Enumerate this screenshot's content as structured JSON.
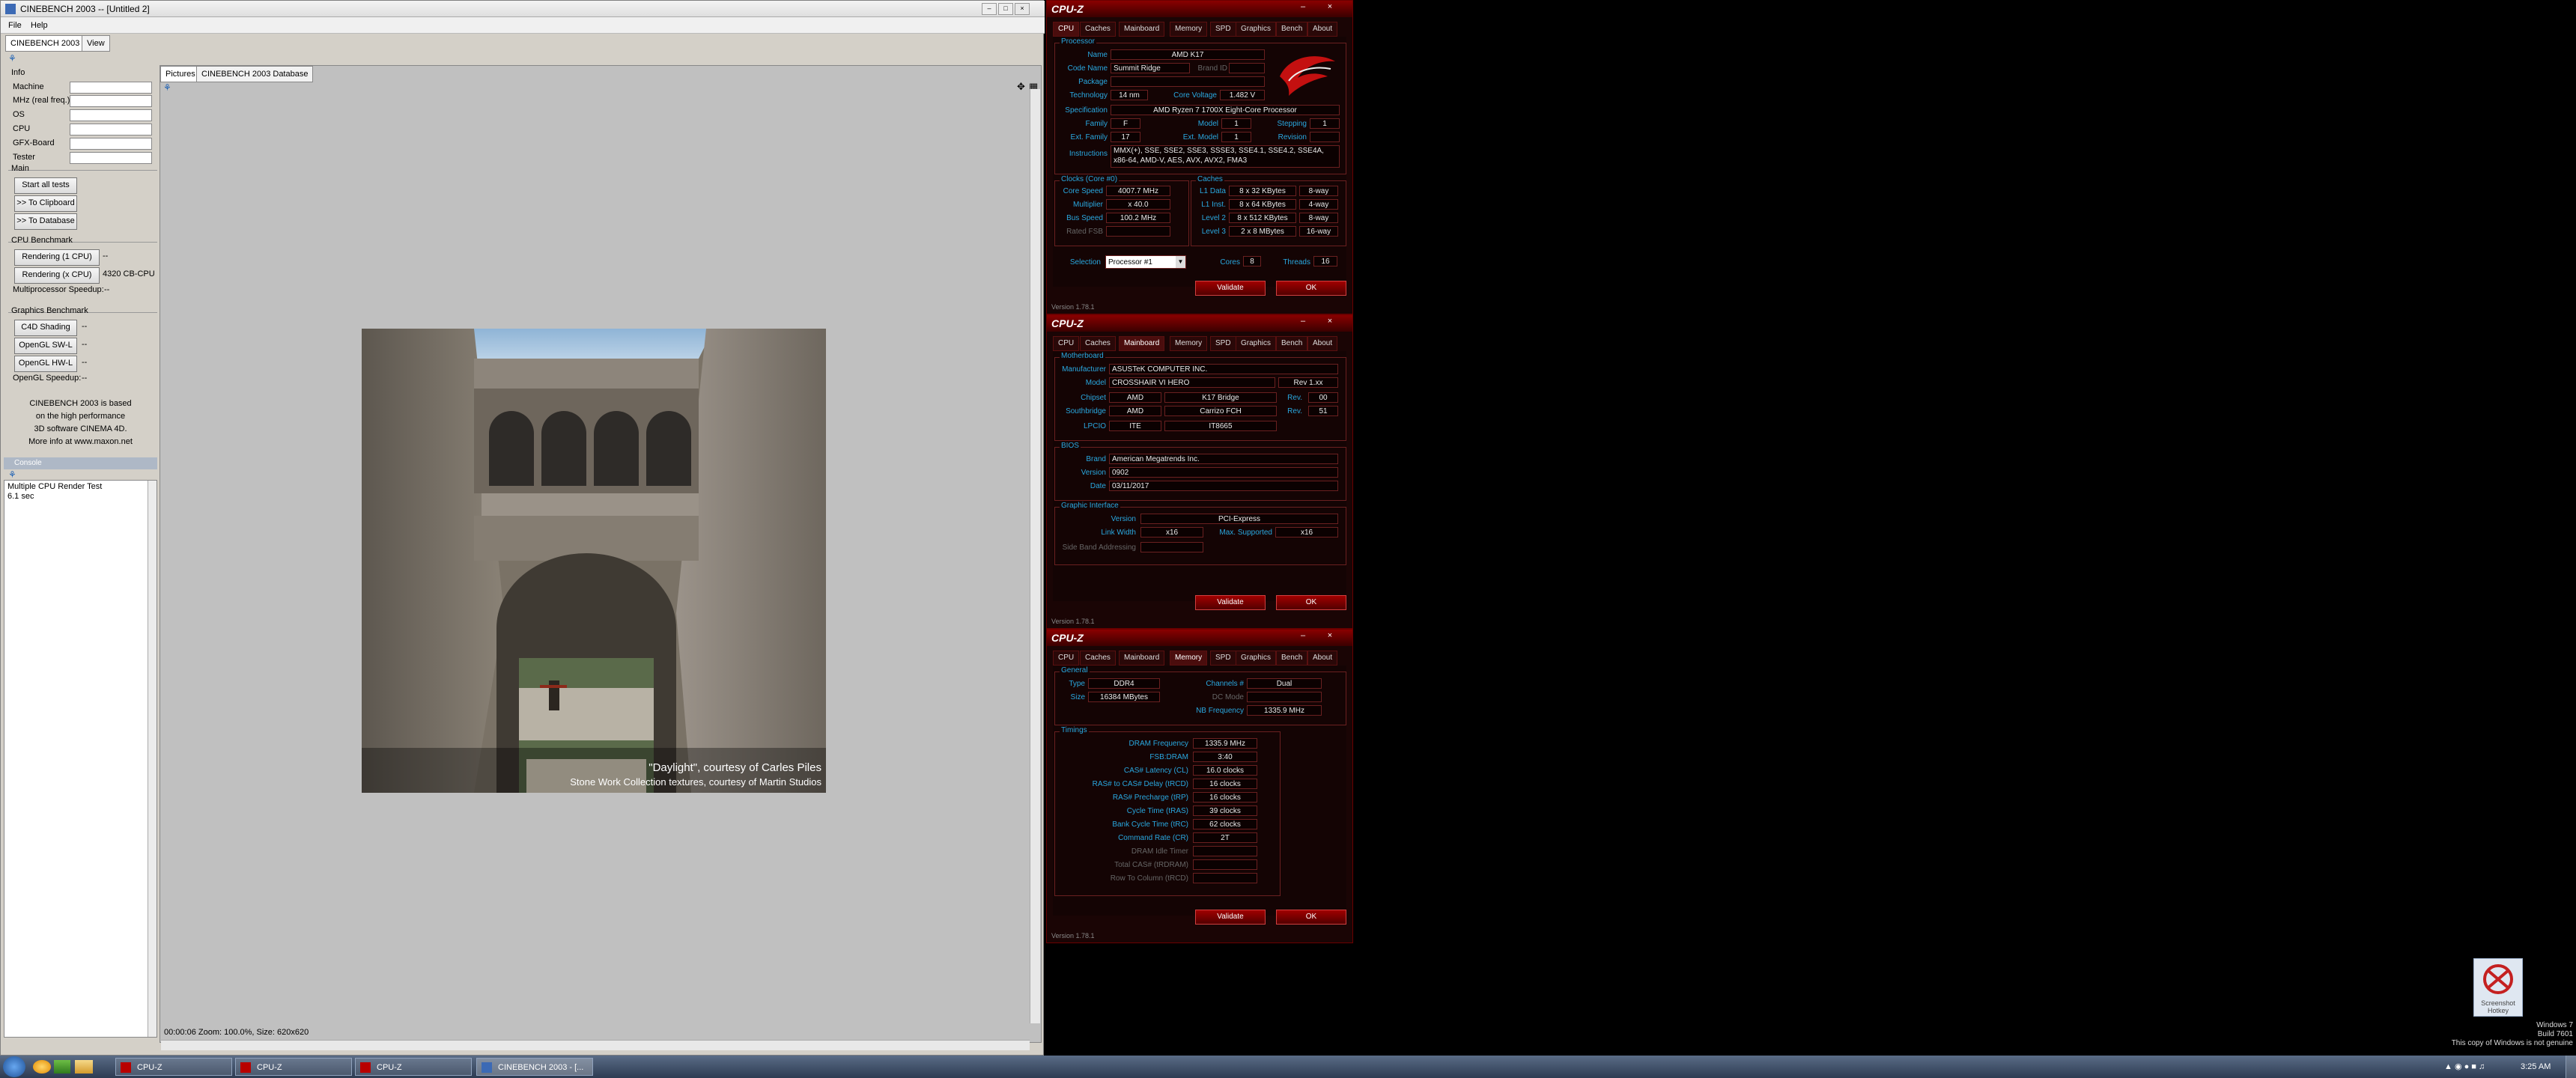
{
  "cinebench": {
    "title": "CINEBENCH 2003 -- [Untitled 2]",
    "menu": [
      "File",
      "Help"
    ],
    "tabs": [
      "CINEBENCH 2003",
      "View"
    ],
    "info": {
      "label": "Info",
      "rows": [
        "Machine",
        "MHz (real freq.)",
        "OS",
        "CPU",
        "GFX-Board",
        "Tester"
      ]
    },
    "main": {
      "label": "Main",
      "buttons": [
        "Start all tests",
        ">> To Clipboard",
        ">> To Database"
      ]
    },
    "cpu_bench": {
      "label": "CPU Benchmark",
      "single": "Rendering (1 CPU)",
      "single_value": "--",
      "multi": "Rendering (x CPU)",
      "multi_value": "4320 CB-CPU",
      "speedup_label": "Multiprocessor Speedup:",
      "speedup_value": "--"
    },
    "gfx_bench": {
      "label": "Graphics Benchmark",
      "items": [
        "C4D Shading",
        "OpenGL SW-L",
        "OpenGL HW-L"
      ],
      "values": [
        "--",
        "--",
        "--"
      ],
      "speedup_label": "OpenGL Speedup:",
      "speedup_value": "--"
    },
    "about": [
      "CINEBENCH 2003 is based",
      "on the high performance",
      "3D software CINEMA 4D.",
      "More info at www.maxon.net"
    ],
    "console": {
      "title": "Console",
      "lines": [
        "Multiple CPU Render Test",
        "6.1 sec"
      ]
    },
    "view_tabs": [
      "Pictures",
      "CINEBENCH 2003 Database"
    ],
    "render_caption": {
      "line1": "\"Daylight\", courtesy of Carles Piles",
      "line2": "Stone Work Collection textures, courtesy of Martin Studios"
    },
    "status": "00:00:06   Zoom: 100.0%, Size: 620x620"
  },
  "cpuz_common": {
    "name": "CPU-Z",
    "tabs": [
      "CPU",
      "Caches",
      "Mainboard",
      "Memory",
      "SPD",
      "Graphics",
      "Bench",
      "About"
    ],
    "validate": "Validate",
    "ok": "OK",
    "version": "Version 1.78.1"
  },
  "cpuz_cpu": {
    "processor": "Processor",
    "name_l": "Name",
    "name": "AMD K17",
    "code_l": "Code Name",
    "code": "Summit Ridge",
    "brand_l": "Brand ID",
    "package_l": "Package",
    "tech_l": "Technology",
    "tech": "14 nm",
    "cv_l": "Core Voltage",
    "cv": "1.482 V",
    "spec_l": "Specification",
    "spec": "AMD Ryzen 7 1700X Eight-Core Processor",
    "family_l": "Family",
    "family": "F",
    "model_l": "Model",
    "model": "1",
    "stepping_l": "Stepping",
    "stepping": "1",
    "extfam_l": "Ext. Family",
    "extfam": "17",
    "extmodel_l": "Ext. Model",
    "extmodel": "1",
    "revision_l": "Revision",
    "instr_l": "Instructions",
    "instr1": "MMX(+), SSE, SSE2, SSE3, SSSE3, SSE4.1, SSE4.2, SSE4A,",
    "instr2": "x86-64, AMD-V, AES, AVX, AVX2, FMA3",
    "clocks": "Clocks (Core #0)",
    "cs_l": "Core Speed",
    "cs": "4007.7 MHz",
    "mult_l": "Multiplier",
    "mult": "x 40.0",
    "bus_l": "Bus Speed",
    "bus": "100.2 MHz",
    "fsb_l": "Rated FSB",
    "caches": "Caches",
    "l1d_l": "L1 Data",
    "l1d": "8 x 32 KBytes",
    "l1d_w": "8-way",
    "l1i_l": "L1 Inst.",
    "l1i": "8 x 64 KBytes",
    "l1i_w": "4-way",
    "l2_l": "Level 2",
    "l2": "8 x 512 KBytes",
    "l2_w": "8-way",
    "l3_l": "Level 3",
    "l3": "2 x 8 MBytes",
    "l3_w": "16-way",
    "sel_l": "Selection",
    "sel": "Processor #1",
    "cores_l": "Cores",
    "cores": "8",
    "threads_l": "Threads",
    "threads": "16"
  },
  "cpuz_mb": {
    "mb": "Motherboard",
    "manu_l": "Manufacturer",
    "manu": "ASUSTeK COMPUTER INC.",
    "model_l": "Model",
    "model": "CROSSHAIR VI HERO",
    "rev": "Rev 1.xx",
    "chip_l": "Chipset",
    "chip1": "AMD",
    "chip2": "K17 Bridge",
    "chiprev_l": "Rev.",
    "chiprev": "00",
    "sb_l": "Southbridge",
    "sb1": "AMD",
    "sb2": "Carrizo FCH",
    "sbrev_l": "Rev.",
    "sbrev": "51",
    "lpc_l": "LPCIO",
    "lpc1": "ITE",
    "lpc2": "IT8665",
    "bios": "BIOS",
    "brand_l": "Brand",
    "brand": "American Megatrends Inc.",
    "ver_l": "Version",
    "ver": "0902",
    "date_l": "Date",
    "date": "03/11/2017",
    "gi": "Graphic Interface",
    "giver_l": "Version",
    "giver": "PCI-Express",
    "lw_l": "Link Width",
    "lw": "x16",
    "ms_l": "Max. Supported",
    "ms": "x16",
    "sba_l": "Side Band Addressing"
  },
  "cpuz_mem": {
    "general": "General",
    "type_l": "Type",
    "type": "DDR4",
    "ch_l": "Channels #",
    "ch": "Dual",
    "size_l": "Size",
    "size": "16384 MBytes",
    "dc_l": "DC Mode",
    "nb_l": "NB Frequency",
    "nb": "1335.9 MHz",
    "timings": "Timings",
    "rows": [
      {
        "l": "DRAM Frequency",
        "v": "1335.9 MHz"
      },
      {
        "l": "FSB:DRAM",
        "v": "3:40"
      },
      {
        "l": "CAS# Latency (CL)",
        "v": "16.0 clocks"
      },
      {
        "l": "RAS# to CAS# Delay (tRCD)",
        "v": "16 clocks"
      },
      {
        "l": "RAS# Precharge (tRP)",
        "v": "16 clocks"
      },
      {
        "l": "Cycle Time (tRAS)",
        "v": "39 clocks"
      },
      {
        "l": "Bank Cycle Time (tRC)",
        "v": "62 clocks"
      },
      {
        "l": "Command Rate (CR)",
        "v": "2T"
      },
      {
        "l": "DRAM Idle Timer",
        "v": ""
      },
      {
        "l": "Total CAS# (tRDRAM)",
        "v": ""
      },
      {
        "l": "Row To Column (tRCD)",
        "v": ""
      }
    ]
  },
  "taskbar": {
    "items": [
      "CPU-Z",
      "CPU-Z",
      "CPU-Z",
      "CINEBENCH 2003 - [..."
    ],
    "clock": "3:25 AM"
  },
  "desktop": {
    "icon_label": "Screenshot Hotkey",
    "wm1": "Windows 7",
    "wm2": "Build 7601",
    "wm3": "This copy of Windows is not genuine"
  }
}
